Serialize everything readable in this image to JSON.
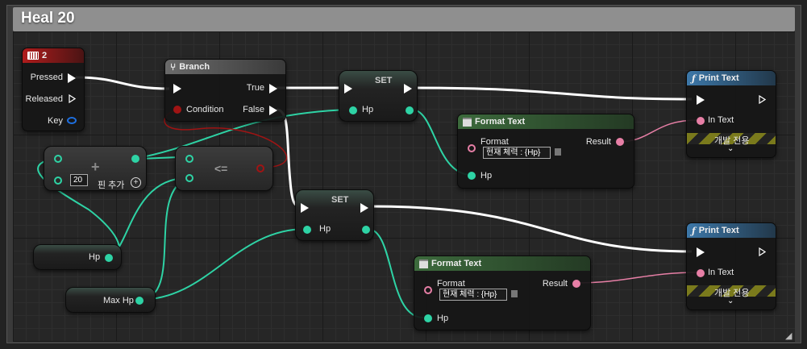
{
  "comment": {
    "title": "Heal 20"
  },
  "key_node": {
    "title": "2",
    "pins": {
      "pressed": "Pressed",
      "released": "Released",
      "key": "Key"
    }
  },
  "branch_node": {
    "title": "Branch",
    "pins": {
      "condition": "Condition",
      "true": "True",
      "false": "False"
    }
  },
  "set_node_top": {
    "title": "SET",
    "pin": "Hp"
  },
  "set_node_bottom": {
    "title": "SET",
    "pin": "Hp"
  },
  "add_node": {
    "operator": "+",
    "value": "20",
    "add_pin": "핀 추가"
  },
  "compare_node": {
    "operator": "<="
  },
  "hp_var": {
    "label": "Hp"
  },
  "maxhp_var": {
    "label": "Max Hp"
  },
  "format_top": {
    "title": "Format Text",
    "format_label": "Format",
    "format_value": "현재 체력 : {Hp}",
    "result": "Result",
    "hp_pin": "Hp"
  },
  "format_bottom": {
    "title": "Format Text",
    "format_label": "Format",
    "format_value": "현재 체력 : {Hp}",
    "result": "Result",
    "hp_pin": "Hp"
  },
  "print_top": {
    "title": "Print Text",
    "in_text": "In Text",
    "dev_only": "개발 전용"
  },
  "print_bottom": {
    "title": "Print Text",
    "in_text": "In Text",
    "dev_only": "개발 전용"
  },
  "colors": {
    "exec": "#ffffff",
    "float": "#2ed3a5",
    "bool": "#a01414",
    "text": "#e77fa6",
    "key_struct": "#1e6fe0"
  },
  "icons": {
    "keyboard": "keyboard-icon",
    "branch": "branch-icon",
    "function": "function-icon",
    "format": "format-text-icon"
  }
}
